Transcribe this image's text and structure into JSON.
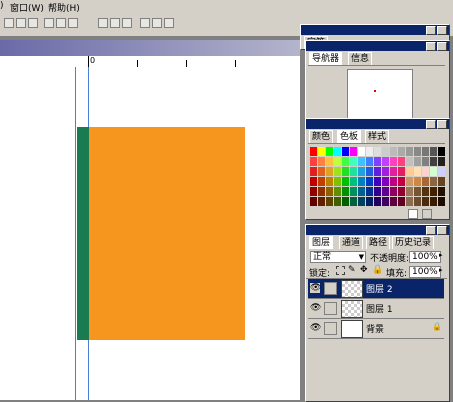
{
  "menubar": {
    "items": [
      "窗口(W)",
      "帮助(H)"
    ],
    "prefix": ")"
  },
  "ruler": {
    "zero_label": "0"
  },
  "navigator": {
    "tabs": [
      "导航器",
      "信息"
    ],
    "behind_tab": "字符"
  },
  "swatches": {
    "tabs": [
      "颜色",
      "色板",
      "样式"
    ],
    "colors": [
      "#ff0000",
      "#ffff00",
      "#00ff00",
      "#00ffff",
      "#0000ff",
      "#ff00ff",
      "#ffffff",
      "#eeeeee",
      "#dddddd",
      "#cccccc",
      "#bbbbbb",
      "#aaaaaa",
      "#999999",
      "#888888",
      "#777777",
      "#555555",
      "#000000",
      "#ff4040",
      "#ff8040",
      "#ffc040",
      "#c0ff40",
      "#40ff40",
      "#40ffc0",
      "#40c0ff",
      "#4080ff",
      "#8040ff",
      "#c040ff",
      "#ff40c0",
      "#ff4080",
      "#c0c0c0",
      "#a0a0a0",
      "#808080",
      "#404040",
      "#202020",
      "#e02020",
      "#e06020",
      "#e0a020",
      "#a0e020",
      "#20e020",
      "#20e0a0",
      "#20a0e0",
      "#2060e0",
      "#6020e0",
      "#a020e0",
      "#e020a0",
      "#e02060",
      "#ffcc99",
      "#ffe0b0",
      "#ffd0d0",
      "#d0ffd0",
      "#d0d0ff",
      "#c00000",
      "#c04000",
      "#c08000",
      "#80c000",
      "#00c000",
      "#00c080",
      "#0080c0",
      "#0040c0",
      "#4000c0",
      "#8000c0",
      "#c00080",
      "#c00040",
      "#cc9966",
      "#cc8844",
      "#aa6633",
      "#886644",
      "#664422",
      "#900000",
      "#903000",
      "#906000",
      "#609000",
      "#009000",
      "#009060",
      "#006090",
      "#003090",
      "#300090",
      "#600090",
      "#900060",
      "#900030",
      "#997755",
      "#775533",
      "#553311",
      "#442200",
      "#221100",
      "#600000",
      "#602000",
      "#604000",
      "#406000",
      "#006000",
      "#006040",
      "#004060",
      "#002060",
      "#200060",
      "#400060",
      "#600040",
      "#600020",
      "#8b6b4b",
      "#6b4b2b",
      "#4b2b0b",
      "#3b1b00",
      "#1b0b00"
    ]
  },
  "layers": {
    "tabs": [
      "图层",
      "通道",
      "路径",
      "历史记录"
    ],
    "blend_mode": "正常",
    "opacity_label": "不透明度:",
    "opacity": "100%",
    "lock_label": "锁定:",
    "fill_label": "填充:",
    "fill": "100%",
    "rows": [
      {
        "name": "图层 2",
        "selected": true
      },
      {
        "name": "图层 1",
        "selected": false
      },
      {
        "name": "背景",
        "selected": false
      }
    ]
  },
  "colors": {
    "orange": "#f7961e",
    "green": "#1a7a50",
    "panel_title": "#0a246a"
  }
}
